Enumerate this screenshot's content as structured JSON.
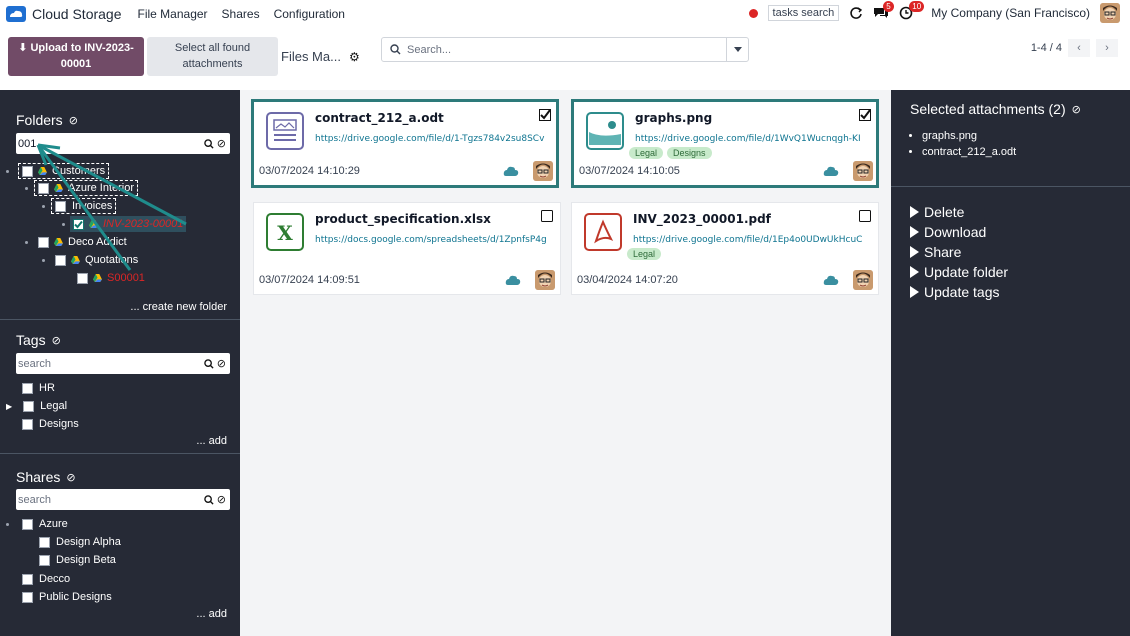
{
  "app": {
    "name": "Cloud Storage"
  },
  "nav": {
    "menu": [
      "File Manager",
      "Shares",
      "Configuration"
    ],
    "tasks_search": "tasks search",
    "messages_count": "5",
    "activities_count": "10",
    "company": "My Company (San Francisco)"
  },
  "control": {
    "upload_label": "Upload to INV-2023-00001",
    "select_all_label": "Select all found attachments",
    "breadcrumb": "Files Ma...",
    "search_placeholder": "Search...",
    "pager": "1-4 / 4"
  },
  "folders": {
    "title": "Folders",
    "search_value": "001",
    "items": [
      {
        "label": "Customers"
      },
      {
        "label": "Azure Interior"
      },
      {
        "label": "Invoices"
      },
      {
        "label": "INV-2023-00001"
      },
      {
        "label": "Deco Addict"
      },
      {
        "label": "Quotations"
      },
      {
        "label": "S00001"
      }
    ],
    "create_label": "... create new folder"
  },
  "tags": {
    "title": "Tags",
    "search_placeholder": "search",
    "items": [
      {
        "label": "HR"
      },
      {
        "label": "Legal"
      },
      {
        "label": "Designs"
      }
    ],
    "add_label": "... add"
  },
  "shares": {
    "title": "Shares",
    "search_placeholder": "search",
    "items": [
      {
        "label": "Azure"
      },
      {
        "label": "Design Alpha"
      },
      {
        "label": "Design Beta"
      },
      {
        "label": "Decco"
      },
      {
        "label": "Public Designs"
      }
    ],
    "add_label": "... add"
  },
  "cards": [
    {
      "name": "contract_212_a.odt",
      "url": "https://drive.google.com/file/d/1-Tgzs784v2su8SCv",
      "tags": [],
      "date": "03/07/2024 14:10:29",
      "selected": true
    },
    {
      "name": "graphs.png",
      "url": "https://drive.google.com/file/d/1WvQ1Wucnqgh-KI",
      "tags": [
        "Legal",
        "Designs"
      ],
      "date": "03/07/2024 14:10:05",
      "selected": true
    },
    {
      "name": "product_specification.xlsx",
      "url": "https://docs.google.com/spreadsheets/d/1ZpnfsP4g",
      "tags": [],
      "date": "03/07/2024 14:09:51",
      "selected": false
    },
    {
      "name": "INV_2023_00001.pdf",
      "url": "https://drive.google.com/file/d/1Ep4o0UDwUkHcuC",
      "tags": [
        "Legal"
      ],
      "date": "03/04/2024 14:07:20",
      "selected": false
    }
  ],
  "selected_panel": {
    "title": "Selected attachments (2)",
    "items": [
      "graphs.png",
      "contract_212_a.odt"
    ],
    "actions": [
      "Delete",
      "Download",
      "Share",
      "Update folder",
      "Update tags"
    ]
  },
  "colors": {
    "brand": "#714b67",
    "sidebar_bg": "#262a36",
    "selected_border": "#2d7a7a",
    "active_folder": "#dc2626",
    "tag_bg": "#c8eacb"
  }
}
